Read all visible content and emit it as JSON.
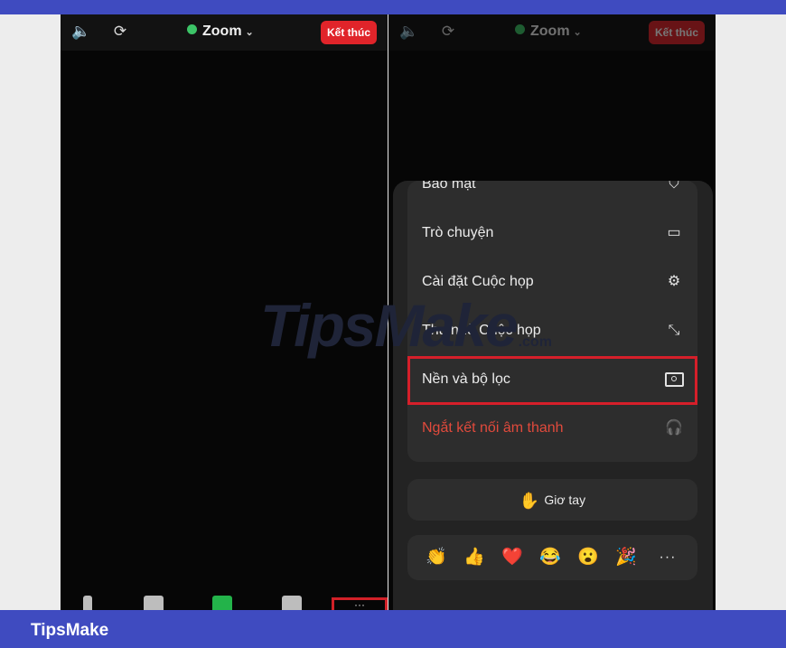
{
  "topbar": {
    "speaker_icon": "speaker-icon",
    "camera_switch_icon": "camera-switch-icon",
    "meeting_label": "Zoom",
    "end_button": "Kết thúc"
  },
  "watermark": {
    "main": "TipsMake",
    "sub": ".com"
  },
  "menu": {
    "items": [
      {
        "label": "Bảo mật",
        "icon": "shield-icon"
      },
      {
        "label": "Trò chuyện",
        "icon": "chat-icon"
      },
      {
        "label": "Cài đặt Cuộc họp",
        "icon": "settings-icon"
      },
      {
        "label": "Thu nhỏ Cuộc họp",
        "icon": "minimize-icon"
      },
      {
        "label": "Nền và bộ lọc",
        "icon": "background-frame-icon",
        "highlighted": true
      },
      {
        "label": "Ngắt kết nối âm thanh",
        "icon": "headphone-disconnect-icon",
        "color": "#e14a3c"
      }
    ]
  },
  "raise_hand": "Giơ tay",
  "reactions": [
    "👏",
    "👍",
    "❤️",
    "😂",
    "😮",
    "🎉"
  ],
  "reactions_more": "···",
  "more_tool": "···",
  "footer": {
    "brand": "TipsMake"
  },
  "colors": {
    "accent": "#3f4bc0",
    "highlight": "#d51f2a",
    "danger": "#e14a3c",
    "end_button": "#e0242a"
  }
}
